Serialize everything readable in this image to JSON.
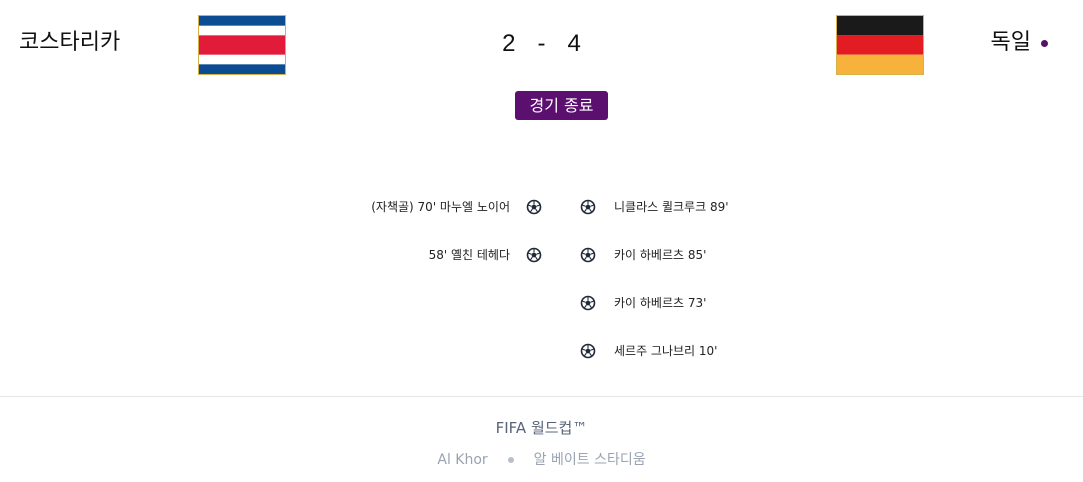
{
  "match": {
    "home": {
      "name": "코스타리카",
      "flag": "costa-rica-flag"
    },
    "away": {
      "name": "독일",
      "flag": "germany-flag"
    },
    "score": {
      "home": "2",
      "separator": "-",
      "away": "4"
    },
    "status": "경기 종료"
  },
  "scorers": {
    "home": [
      {
        "text": "(자책골) 70' 마누엘 노이어",
        "icon": "soccer-ball-icon"
      },
      {
        "text": "58' 옐친 테헤다",
        "icon": "soccer-ball-icon"
      }
    ],
    "away": [
      {
        "text": "니클라스 퀼크루크 89'",
        "icon": "soccer-ball-icon"
      },
      {
        "text": "카이 하베르츠 85'",
        "icon": "soccer-ball-icon"
      },
      {
        "text": "카이 하베르츠 73'",
        "icon": "soccer-ball-icon"
      },
      {
        "text": "세르주 그나브리 10'",
        "icon": "soccer-ball-icon"
      }
    ]
  },
  "footer": {
    "competition": "FIFA 월드컵™",
    "city": "Al Khor",
    "stadium": "알 베이트 스타디움"
  },
  "colors": {
    "accent": "#5b0f6e",
    "costa_rica_blue": "#0b4c93",
    "costa_rica_red": "#e31b3b",
    "germany_black": "#1a1a1a",
    "germany_red": "#e31b23",
    "germany_gold": "#f6b23a"
  }
}
